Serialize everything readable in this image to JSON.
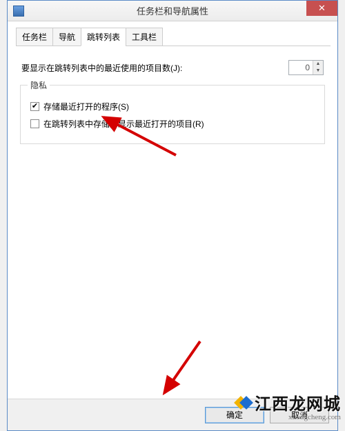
{
  "window": {
    "title": "任务栏和导航属性",
    "close": "✕"
  },
  "tabs": {
    "t0": "任务栏",
    "t1": "导航",
    "t2": "跳转列表",
    "t3": "工具栏"
  },
  "jump": {
    "label": "要显示在跳转列表中的最近使用的项目数(J):",
    "value": "0"
  },
  "privacy": {
    "title": "隐私",
    "c1": "存储最近打开的程序(S)",
    "c2": "在跳转列表中存储并显示最近打开的项目(R)"
  },
  "buttons": {
    "ok": "确定",
    "cancel": "取消"
  },
  "watermark": {
    "text": "江西龙网城",
    "sub": "xitongcheng.com"
  }
}
